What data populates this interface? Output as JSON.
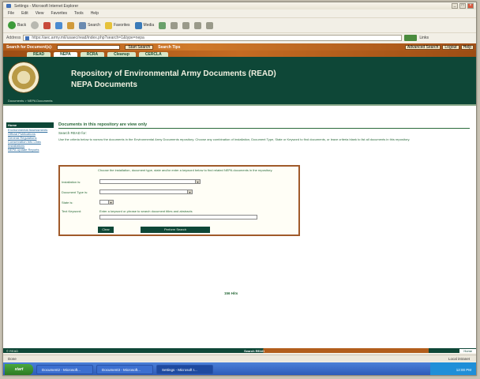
{
  "window": {
    "title": "Settings - Microsoft Internet Explorer"
  },
  "menu": [
    "File",
    "Edit",
    "View",
    "Favorites",
    "Tools",
    "Help"
  ],
  "toolbar": {
    "back": "Back",
    "search": "Search",
    "favorites": "Favorites",
    "media": "Media"
  },
  "address": {
    "label": "Address",
    "url": "https://aec.army.mil/usaec/read/index.php?search=1&type=nepa",
    "go": "Go",
    "links": "Links"
  },
  "site": {
    "search_label": "Search for Document(s):",
    "search_button": "Start Search",
    "search_tips": "Search Tips",
    "top_buttons": [
      "Advanced Search",
      "Logout",
      "Help"
    ],
    "nav_tabs": [
      "READ",
      "NEPA",
      "RCRA",
      "Cleanup",
      "CERCLA"
    ],
    "title_line1": "Repository of Environmental Army Documents (READ)",
    "title_line2": "NEPA Documents",
    "breadcrumb": "Documents > NEPA Documents"
  },
  "sidebar": {
    "header": "Home",
    "links": [
      "Environmental Assessments",
      "Official Publications",
      "General Regulations",
      "Conservation Info Links",
      "Installations",
      "NEPA Update Reports"
    ]
  },
  "main": {
    "heading": "Documents in this repository are view only",
    "subheading": "Search READ for:",
    "help_text": "Use the criteria below to narrow the documents in the Environmental Army Documents repository. Choose any combination of Installation, Document Type, State or Keyword to find documents, or leave criteria blank to list all documents in this repository.",
    "form_intro": "Choose the installation, document type, state and/or enter a keyword below to find related NEPA documents in the repository.",
    "fields": {
      "installation_label": "Installation is:",
      "doctype_label": "Document Type is:",
      "state_label": "State is:",
      "keyword_label": "Text Keyword:",
      "keyword_help": "Enter a keyword or phrase to search document titles and abstracts"
    },
    "clear_button": "Clear",
    "search_button": "Perform Search",
    "hits": "156 Hits"
  },
  "footer": {
    "left": "© READ",
    "mid": "Search READ",
    "right_tab": "Home"
  },
  "status": {
    "left": "Done",
    "right": "Local intranet"
  },
  "taskbar": {
    "start": "start",
    "tasks": [
      "Document2 - Microsoft...",
      "Document3 - Microsoft...",
      "Settings - Microsoft I..."
    ],
    "clock": "12:00 PM"
  }
}
